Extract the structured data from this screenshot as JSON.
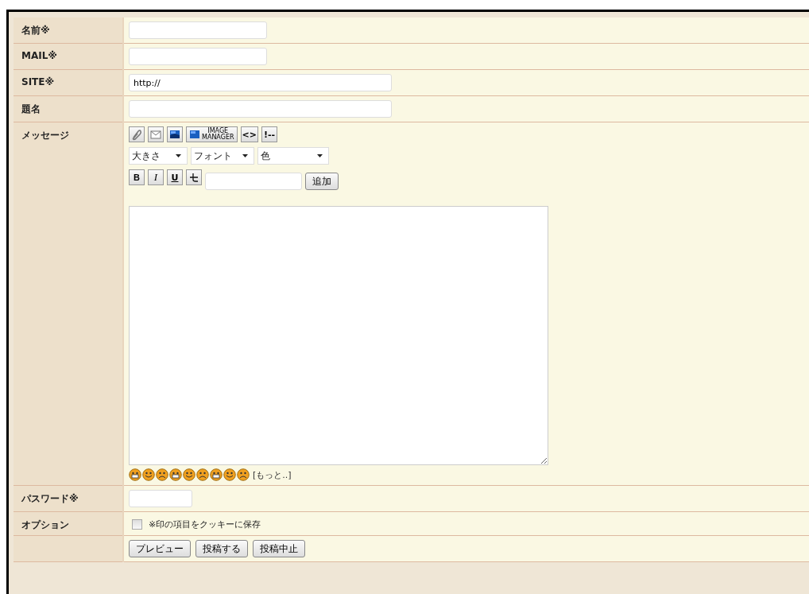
{
  "form": {
    "rows": [
      {
        "kind": "field",
        "label": "名前※",
        "value": ""
      },
      {
        "kind": "field",
        "label": "MAIL※",
        "value": ""
      },
      {
        "kind": "widefield",
        "label": "SITE※",
        "value": "http://"
      },
      {
        "kind": "widefield",
        "label": "題名",
        "value": ""
      },
      {
        "kind": "message",
        "label": "メッセージ"
      },
      {
        "kind": "smallfield",
        "label": "パスワード※",
        "value": ""
      },
      {
        "kind": "option",
        "label": "オプション"
      },
      {
        "kind": "buttons"
      }
    ]
  },
  "toolbar": {
    "tools": [
      {
        "kind": "clip"
      },
      {
        "kind": "mail"
      },
      {
        "kind": "image"
      },
      {
        "kind": "manager",
        "text": [
          "IMAGE",
          "MANAGER"
        ]
      },
      {
        "kind": "char",
        "text": "<>"
      },
      {
        "kind": "char",
        "text": "!--"
      }
    ],
    "selects": [
      "大きさ",
      "フォント",
      "色"
    ],
    "format": [
      {
        "kind": "bold",
        "text": "B"
      },
      {
        "kind": "italic",
        "text": "I"
      },
      {
        "kind": "underline",
        "text": "U"
      },
      {
        "kind": "strike"
      }
    ],
    "add_button": "追加"
  },
  "emoticons": {
    "faces": [
      {
        "kind": "grin"
      },
      {
        "kind": "smile"
      },
      {
        "kind": "sad"
      },
      {
        "kind": "grin"
      },
      {
        "kind": "smile"
      },
      {
        "kind": "sad"
      },
      {
        "kind": "grin"
      },
      {
        "kind": "smile"
      },
      {
        "kind": "sad"
      }
    ],
    "more": "[もっと..]"
  },
  "option": {
    "label": "※印の項目をクッキーに保存",
    "checked": false
  },
  "buttons": [
    "プレビュー",
    "投稿する",
    "投稿中止"
  ]
}
